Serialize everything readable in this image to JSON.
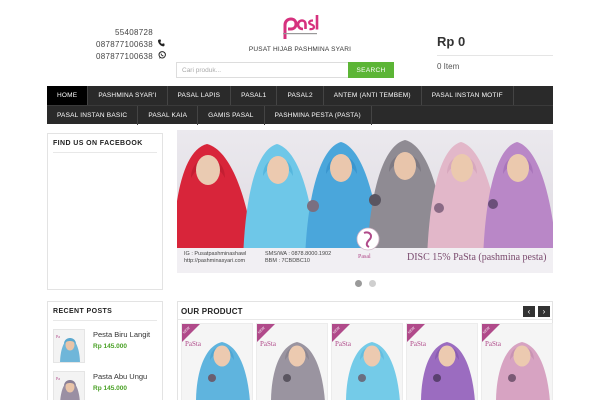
{
  "header": {
    "contacts": [
      {
        "text": "55408728",
        "icon": ""
      },
      {
        "text": "087877100638",
        "icon": "phone-icon"
      },
      {
        "text": "087877100638",
        "icon": "whatsapp-icon"
      }
    ],
    "tagline": "PUSAT HIJAB PASHMINA SYARI",
    "search": {
      "placeholder": "Cari produk...",
      "button": "SEARCH"
    },
    "cart": {
      "total": "Rp 0",
      "items": "0 Item"
    }
  },
  "nav": {
    "row1": [
      "HOME",
      "PASHMINA SYAR'I",
      "PASAL LAPIS",
      "PASAL1",
      "PASAL2",
      "ANTEM (ANTI TEMBEM)",
      "PASAL INSTAN MOTIF"
    ],
    "row2": [
      "PASAL INSTAN BASIC",
      "PASAL KAIA",
      "GAMIS PASAL",
      "PASHMINA PESTA (PASTA)"
    ]
  },
  "sidebar": {
    "facebook_title": "FIND US ON FACEBOOK",
    "recent_title": "RECENT POSTS",
    "posts": [
      {
        "title": "Pesta Biru Langit",
        "price": "Rp 145.000"
      },
      {
        "title": "Pasta Abu Ungu",
        "price": "Rp 145.000"
      }
    ]
  },
  "slider": {
    "caption_lines": [
      "IG : Pusatpashminashawl",
      "http://pashminasyari.com"
    ],
    "caption_lines2": [
      "SMS/WA : 0878.8000.1902",
      "BBM : 7CBDBC10"
    ],
    "logo_text": "Pasal",
    "discount": "DISC 15% PaSta (pashmina pesta)"
  },
  "products": {
    "title": "OUR PRODUCT",
    "prev": "‹",
    "next": "›",
    "badge": "NEW",
    "brand": "PaSta"
  },
  "colors": {
    "accent_green": "#5cb536",
    "nav_bg": "#2a2a2a",
    "price_green": "#4aa126",
    "logo_pink": "#d6317e"
  }
}
